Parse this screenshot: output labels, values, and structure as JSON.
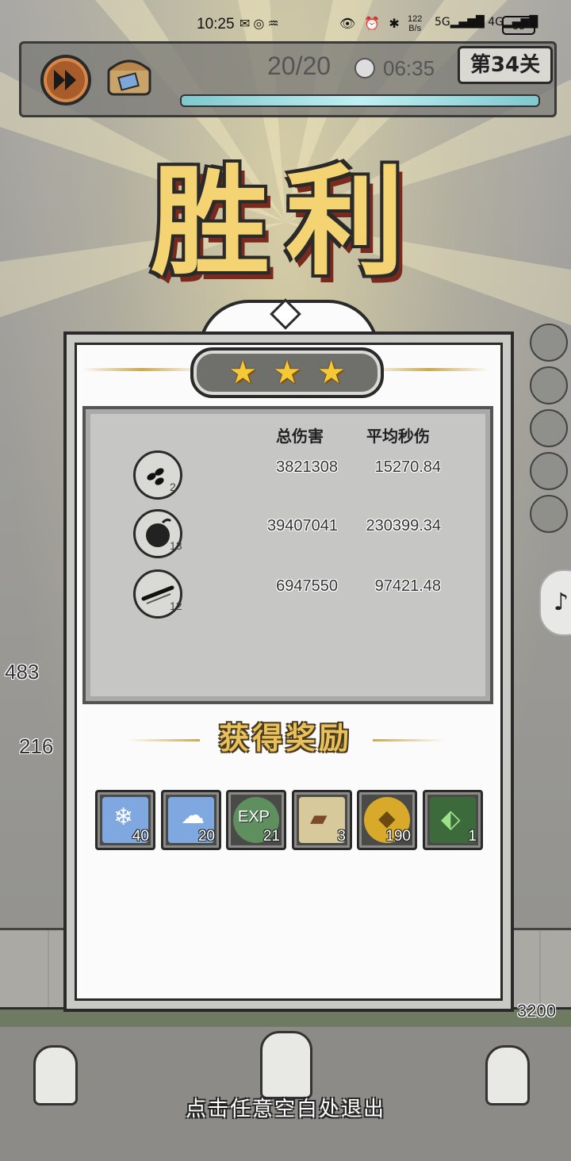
{
  "status_bar": {
    "time": "10:25",
    "net_speed": "122\nB/s",
    "battery": "53"
  },
  "hud": {
    "wave": "20/20",
    "timer": "06:35",
    "level": "第34关",
    "progress_fraction": 1.0
  },
  "title": "胜利",
  "stars": 3,
  "stats": {
    "headers": [
      "总伤害",
      "平均秒伤"
    ],
    "rows": [
      {
        "skill_icon": "triple-bomb-icon",
        "level": "2",
        "total_damage": "3821308",
        "avg_dps": "15270.84"
      },
      {
        "skill_icon": "bomb-icon",
        "level": "13",
        "total_damage": "39407041",
        "avg_dps": "230399.34"
      },
      {
        "skill_icon": "arrow-streak-icon",
        "level": "12",
        "total_damage": "6947550",
        "avg_dps": "97421.48"
      }
    ]
  },
  "rewards": {
    "title": "获得奖励",
    "items": [
      {
        "icon": "crystal-shards-icon",
        "count": "40",
        "color": "#6f9fd8"
      },
      {
        "icon": "ghost-crystal-icon",
        "count": "20",
        "color": "#6f9fd8"
      },
      {
        "icon": "exp-icon",
        "label": "EXP",
        "count": "21",
        "color": "#5a8a5a"
      },
      {
        "icon": "scroll-boot-icon",
        "count": "3",
        "color": "#d8c99a"
      },
      {
        "icon": "gold-coin-icon",
        "count": "190",
        "color": "#d9a92c"
      },
      {
        "icon": "green-gem-icon",
        "count": "1",
        "color": "#3d6a3a"
      }
    ]
  },
  "side": {
    "hp_left_1": "483",
    "hp_left_2": "216",
    "base_hp": "3200"
  },
  "exit_hint": "点击任意空白处退出"
}
